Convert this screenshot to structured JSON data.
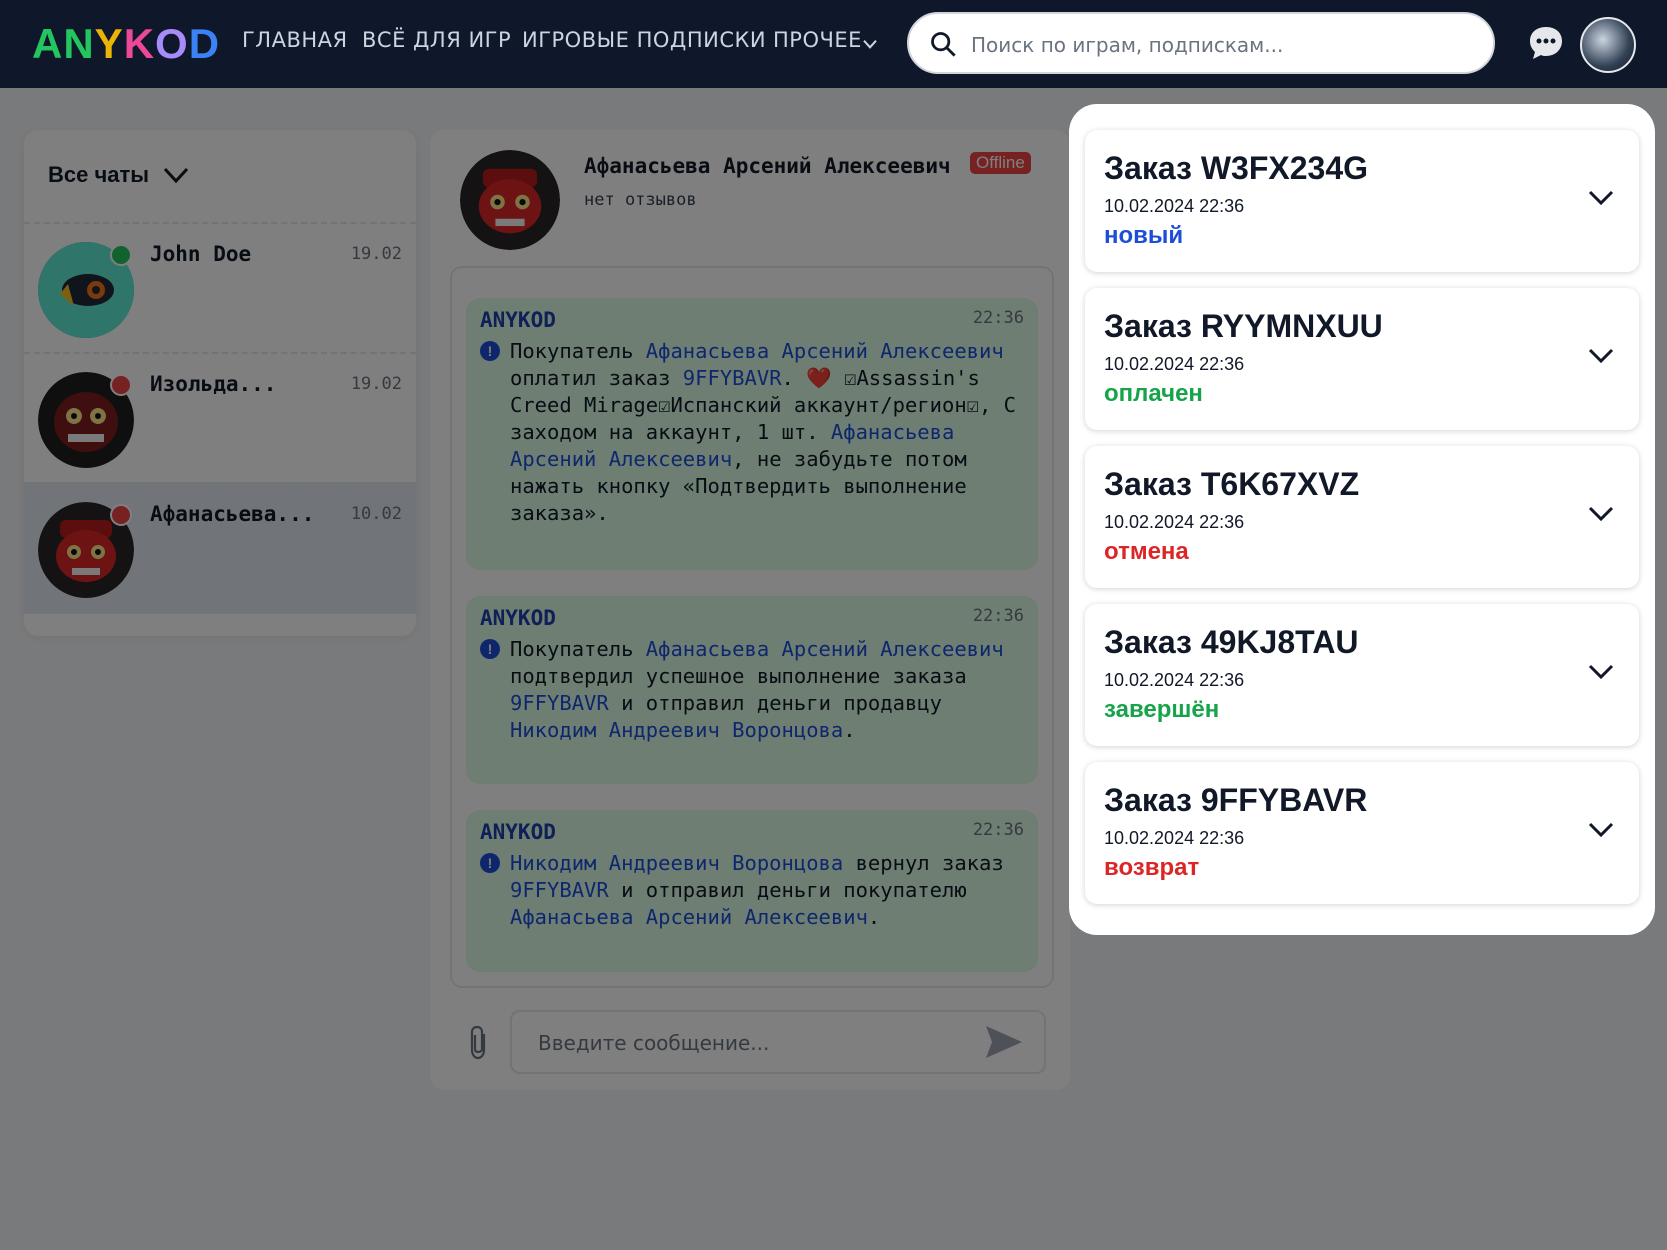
{
  "header": {
    "logo_parts": [
      "AN",
      "Y",
      "K",
      "O",
      "D"
    ],
    "nav": [
      "ГЛАВНАЯ",
      "ВСЁ ДЛЯ ИГР",
      "ИГРОВЫЕ ПОДПИСКИ",
      "ПРОЧЕЕ"
    ],
    "search_placeholder": "Поиск по играм, подпискам..."
  },
  "sidebar": {
    "filter_label": "Все чаты",
    "chats": [
      {
        "name": "John Doe",
        "date": "19.02",
        "status_color": "#22c55e"
      },
      {
        "name": "Изольда...",
        "date": "19.02",
        "status_color": "#ef4444"
      },
      {
        "name": "Афанасьева...",
        "date": "10.02",
        "status_color": "#ef4444"
      }
    ]
  },
  "chat": {
    "contact_name": "Афанасьева Арсений Алексеевич",
    "presence": "Offline",
    "reviews": "нет отзывов",
    "messages": [
      {
        "sender": "ANYKOD",
        "time": "22:36",
        "parts": [
          "Покупатель ",
          "Афанасьева Арсений Алексеевич",
          " оплатил заказ ",
          "9FFYBAVR",
          ". ",
          "❤️",
          " ☑Assassin's Creed Mirage☑Испанский аккаунт/регион☑, С заходом на аккаунт, 1 шт. ",
          "Афанасьева Арсений Алексеевич",
          ", не забудьте потом нажать кнопку «Подтвердить выполнение заказа»."
        ]
      },
      {
        "sender": "ANYKOD",
        "time": "22:36",
        "parts": [
          "Покупатель ",
          "Афанасьева Арсений Алексеевич",
          " подтвердил успешное выполнение заказа ",
          "9FFYBAVR",
          " и отправил деньги продавцу ",
          "Никодим Андреевич Воронцова",
          "."
        ]
      },
      {
        "sender": "ANYKOD",
        "time": "22:36",
        "parts": [
          "Никодим Андреевич Воронцова",
          " вернул заказ ",
          "9FFYBAVR",
          " и отправил деньги покупателю ",
          "Афанасьева Арсений Алексеевич",
          "."
        ]
      }
    ],
    "composer_placeholder": "Введите сообщение..."
  },
  "orders": [
    {
      "title": "Заказ W3FX234G",
      "date": "10.02.2024 22:36",
      "status": "новый",
      "status_color": "#1d4ed8"
    },
    {
      "title": "Заказ RYYMNXUU",
      "date": "10.02.2024 22:36",
      "status": "оплачен",
      "status_color": "#16a34a"
    },
    {
      "title": "Заказ T6K67XVZ",
      "date": "10.02.2024 22:36",
      "status": "отмена",
      "status_color": "#dc2626"
    },
    {
      "title": "Заказ 49KJ8TAU",
      "date": "10.02.2024 22:36",
      "status": "завершён",
      "status_color": "#16a34a"
    },
    {
      "title": "Заказ 9FFYBAVR",
      "date": "10.02.2024 22:36",
      "status": "возврат",
      "status_color": "#dc2626"
    }
  ]
}
